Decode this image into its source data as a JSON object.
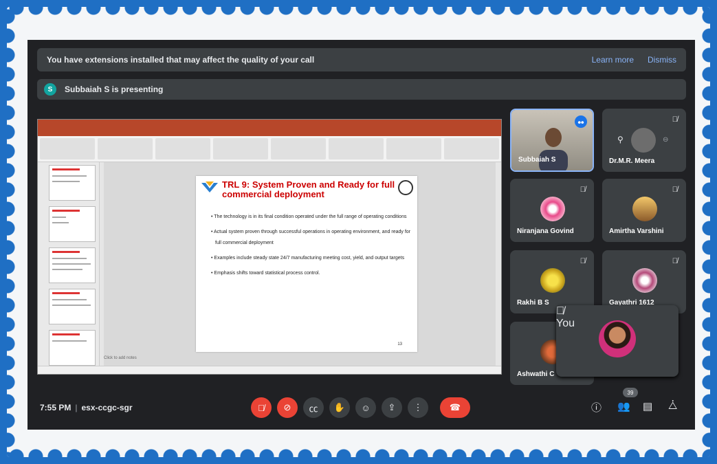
{
  "banner": {
    "text": "You have extensions installed that may affect the quality of your call",
    "learn_more": "Learn more",
    "dismiss": "Dismiss"
  },
  "presenting": {
    "initial": "S",
    "text": "Subbaiah S is presenting"
  },
  "slide": {
    "title": "TRL 9: System Proven and Ready for full commercial deployment",
    "bullets": [
      "The technology is in its final condition operated under the full range of operating conditions",
      "Actual system proven through successful operations in operating environment, and ready for full commercial deployment",
      "Examples include steady state 24/7 manufacturing meeting cost, yield, and output targets",
      "Emphasis shifts toward statistical process control."
    ],
    "page": "13",
    "notes_placeholder": "Click to add notes"
  },
  "participants": [
    {
      "name": "Subbaiah S"
    },
    {
      "name": "Dr.M.R. Meera"
    },
    {
      "name": "Niranjana Govind"
    },
    {
      "name": "Amirtha Varshini"
    },
    {
      "name": "Rakhi B S"
    },
    {
      "name": "Gayathri 1612"
    },
    {
      "name": "Ashwathi C"
    }
  ],
  "self": {
    "name": "You"
  },
  "footer": {
    "time": "7:55 PM",
    "separator": "|",
    "meeting_code": "esx-ccgc-sgr",
    "participant_count": "39"
  },
  "colors": {
    "accent": "#1a73e8",
    "danger": "#ea4335",
    "frame": "#1f6fc4"
  }
}
